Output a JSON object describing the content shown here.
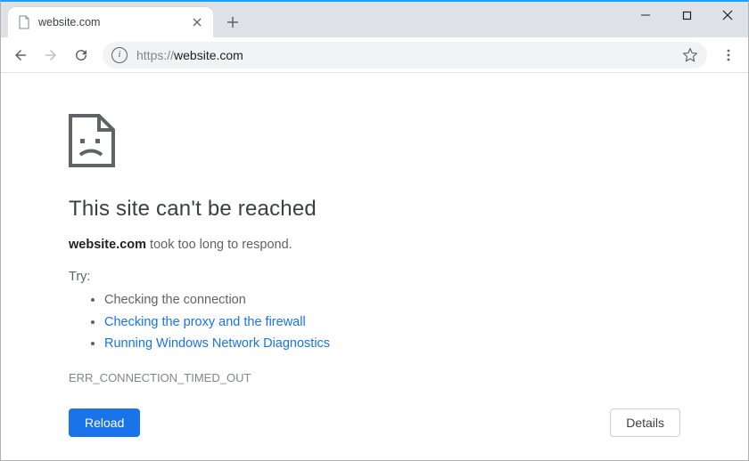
{
  "window": {
    "tab_title": "website.com"
  },
  "toolbar": {
    "url_scheme": "https://",
    "url_rest": "website.com"
  },
  "error": {
    "heading": "This site can't be reached",
    "host": "website.com",
    "message_rest": " took too long to respond.",
    "try_label": "Try:",
    "suggestions": [
      {
        "text": "Checking the connection",
        "link": false
      },
      {
        "text": "Checking the proxy and the firewall",
        "link": true
      },
      {
        "text": "Running Windows Network Diagnostics",
        "link": true
      }
    ],
    "code": "ERR_CONNECTION_TIMED_OUT",
    "reload_label": "Reload",
    "details_label": "Details"
  }
}
